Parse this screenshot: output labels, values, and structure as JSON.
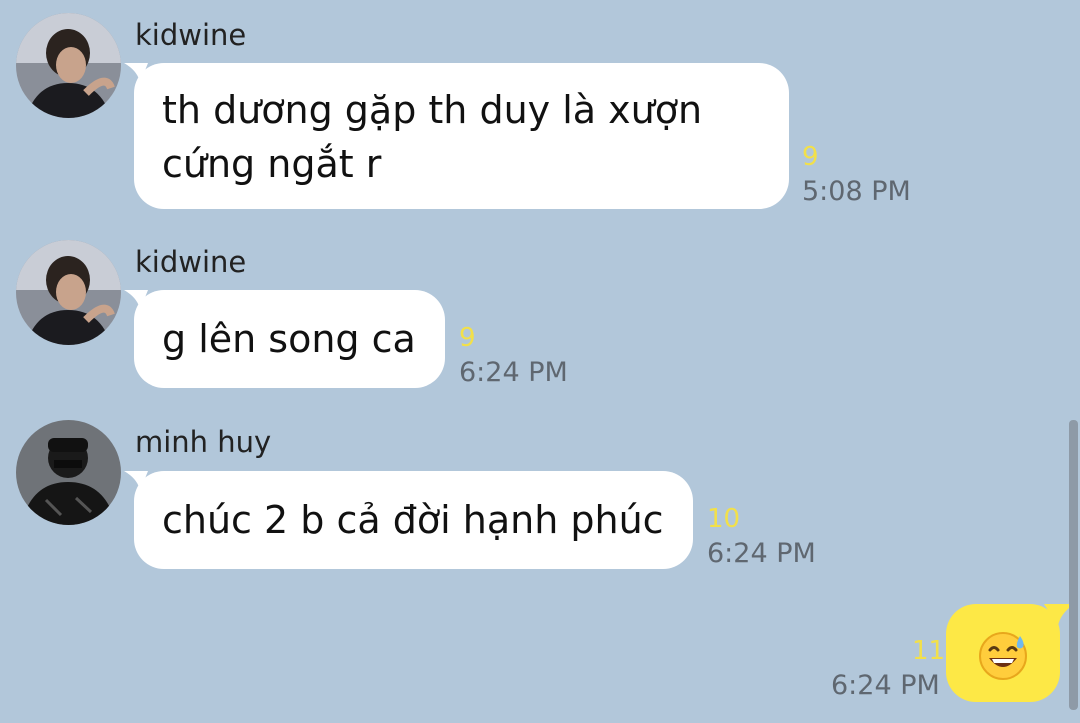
{
  "messages": [
    {
      "sender": "kidwine",
      "lines": [
        "th dương gặp th duy là xượn",
        "cứng ngắt r"
      ],
      "count": "9",
      "time": "5:08 PM"
    },
    {
      "sender": "kidwine",
      "lines": [
        "g lên song ca"
      ],
      "count": "9",
      "time": "6:24 PM"
    },
    {
      "sender": "minh huy",
      "lines": [
        "chúc 2 b cả đời hạnh phúc"
      ],
      "count": "10",
      "time": "6:24 PM"
    }
  ],
  "my_message": {
    "content": "smiling-face-with-sweat-emoji",
    "count": "11",
    "time": "6:24 PM"
  },
  "colors": {
    "background": "#b2c7da",
    "bubble": "#ffffff",
    "my_bubble": "#fde846",
    "unread_count": "#f2e04a",
    "time": "#5f6770"
  }
}
